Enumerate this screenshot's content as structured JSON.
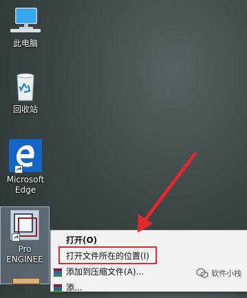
{
  "desktop": {
    "icons": [
      {
        "label": "此电脑",
        "icon": "computer-icon"
      },
      {
        "label": "回收站",
        "icon": "recycle-bin-icon"
      },
      {
        "label": "Microsoft\nEdge",
        "icon": "edge-icon"
      },
      {
        "label": "Pro\nENGINEE",
        "icon": "pro-engineer-icon"
      }
    ]
  },
  "context_menu": {
    "items": [
      {
        "label": "打开(O)",
        "bold": true
      },
      {
        "label": "打开文件所在的位置(I)",
        "bold": false,
        "highlighted": true
      },
      {
        "label": "添加到压缩文件(A)...",
        "bold": false,
        "icon": "winrar-icon"
      },
      {
        "label": "添...",
        "bold": false,
        "icon": "winrar-icon"
      }
    ]
  },
  "annotation": {
    "color": "#e2282c"
  },
  "watermark": {
    "text": "软件小栈",
    "icon": "wechat-icon"
  }
}
